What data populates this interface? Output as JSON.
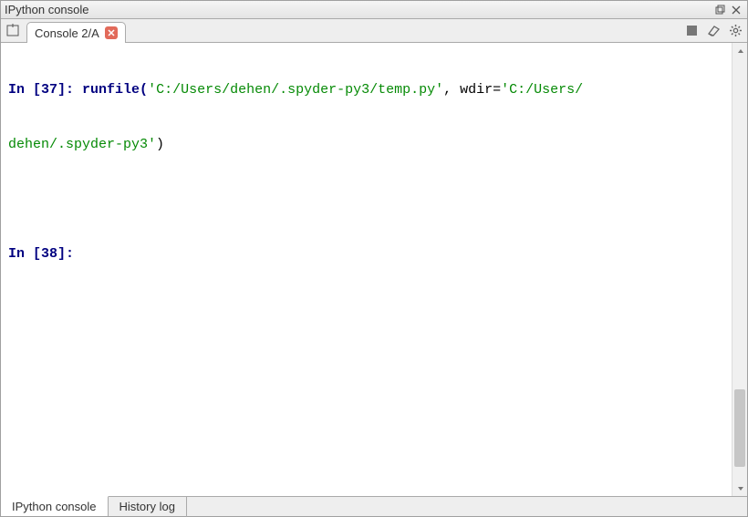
{
  "titlebar": {
    "title": "IPython console"
  },
  "tabs": {
    "active": {
      "label": "Console 2/A"
    }
  },
  "console": {
    "partial_line_prefix": "In [",
    "partial_prompt_num": "37",
    "partial_line_mid": "]: runfile(",
    "partial_green1": "'C:/Users/dehen/.spyder-py3/temp.py'",
    "partial_black": ", wdir=",
    "partial_green2": "'C:/Users/",
    "cont_green": "dehen/.spyder-py3'",
    "cont_black_close": ")",
    "prompt_in": "In [",
    "prompt_num": "38",
    "prompt_close": "]: "
  },
  "bottom_tabs": {
    "ipython": "IPython console",
    "history": "History log"
  }
}
